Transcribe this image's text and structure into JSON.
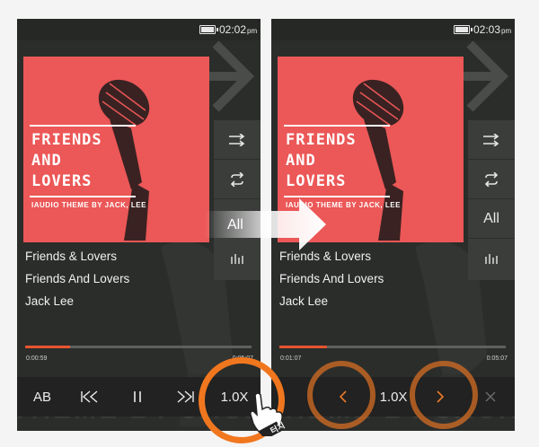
{
  "screens": [
    {
      "status_time": "02:02",
      "status_ampm": "pm",
      "album": {
        "title": "FRIENDS\nAND\nLOVERS",
        "subtitle": "IAUDIO THEME BY JACK, LEE"
      },
      "track": {
        "line1": "Friends & Lovers",
        "line2": "Friends And Lovers",
        "line3": "Jack Lee"
      },
      "progress": {
        "fraction": 0.2,
        "elapsed": "0:00:59",
        "total": "0:05:07"
      },
      "side_buttons": [
        "shuffle-icon",
        "repeat-icon",
        "equalizer-icon"
      ],
      "controls": {
        "ab_label": "AB",
        "speed_label": "1.0X"
      },
      "bg_text": "THEME BY JACK. LEE"
    },
    {
      "status_time": "02:03",
      "status_ampm": "pm",
      "album": {
        "title": "FRIENDS\nAND\nLOVERS",
        "subtitle": "IAUDIO THEME BY JACK, LEE"
      },
      "track": {
        "line1": "Friends & Lovers",
        "line2": "Friends And Lovers",
        "line3": "Jack Lee"
      },
      "progress": {
        "fraction": 0.21,
        "elapsed": "0:01:07",
        "total": "0:05:07"
      },
      "side_buttons": [
        "shuffle-icon",
        "repeat-icon",
        "all-label",
        "equalizer-icon"
      ],
      "side_all_label": "All",
      "controls": {
        "speed_label": "1.0X",
        "decrease_icon": "chevron-left-icon",
        "increase_icon": "chevron-right-icon",
        "close_icon": "close-icon"
      },
      "bg_text": "THEME BY JACK. LEE"
    }
  ],
  "transition_label": "All",
  "tap_label": "터치",
  "colors": {
    "accent": "#ee7a27",
    "album": "#ec5757",
    "phone_bg": "#2b2d2b"
  }
}
